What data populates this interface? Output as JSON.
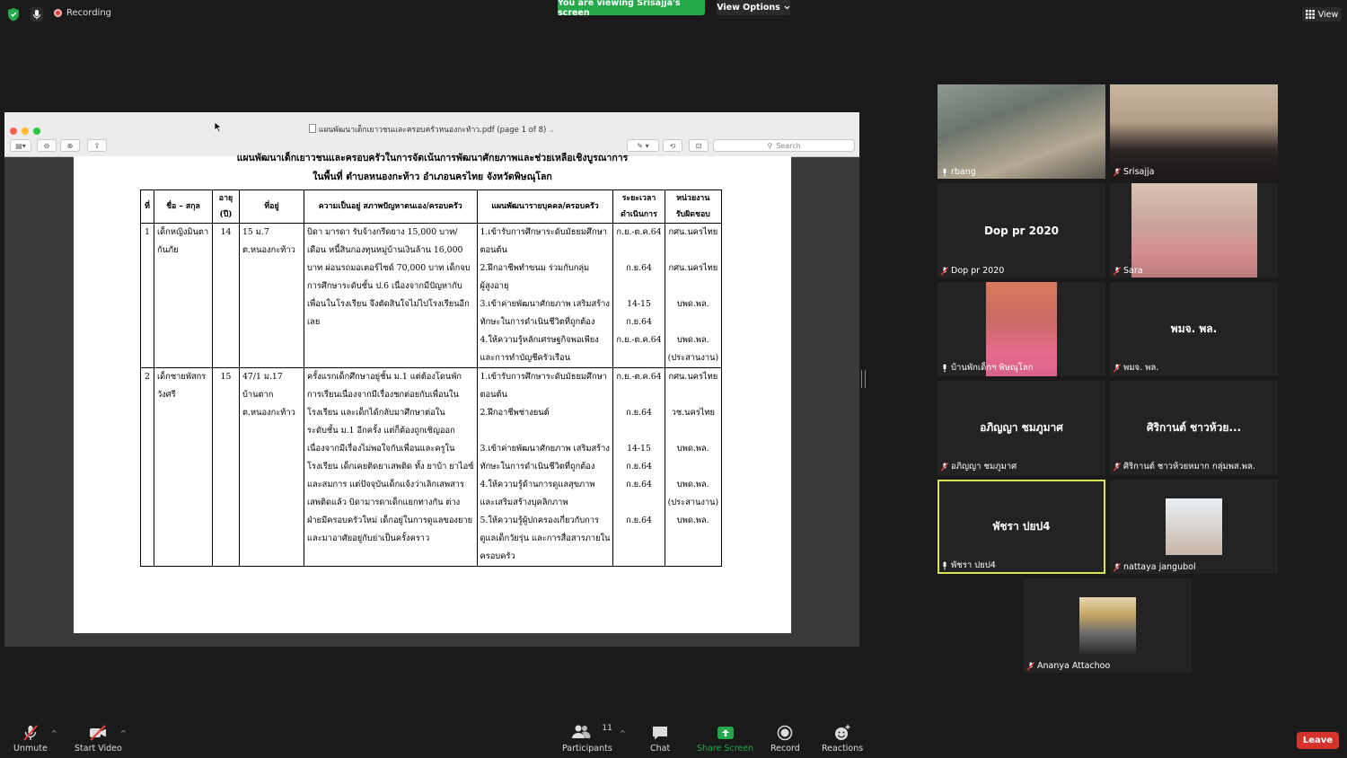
{
  "topbar": {
    "recording_label": "Recording",
    "viewing_banner": "You are viewing Srisajja's screen",
    "view_options_label": "View Options",
    "view_label": "View",
    "colors": {
      "banner_green": "#23a94a",
      "recording_red": "#e2403b"
    }
  },
  "preview": {
    "title": "แผนพัฒนาเด็กเยาวชนและครอบครัวหนองกะท้าว.pdf (page 1 of 8)",
    "search_placeholder": "Search"
  },
  "document": {
    "heading_1": "แผนพัฒนาเด็กเยาวชนและครอบครัวในการจัดเน้นการพัฒนาศักยภาพและช่วยเหลือเชิงบูรณาการ",
    "heading_2": "ในพื้นที่ ตำบลหนองกะท้าว อำเภอนครไทย จังหวัดพิษณุโลก",
    "headers": {
      "no": "ที่",
      "name": "ชื่อ – สกุล",
      "age_1": "อายุ",
      "age_2": "(ปี)",
      "address": "ที่อยู่",
      "situation": "ความเป็นอยู่ สภาพปัญหาตนเอง/ครอบครัว",
      "plan": "แผนพัฒนารายบุคคล/ครอบครัว",
      "period_1": "ระยะเวลา",
      "period_2": "ดำเนินการ",
      "agency_1": "หน่วยงาน",
      "agency_2": "รับผิดชอบ"
    },
    "rows": [
      {
        "no": "1",
        "name": [
          "เด็กหญิงมินตา",
          "กันภัย"
        ],
        "age": "14",
        "address": [
          "15 ม.7",
          "ต.หนองกะท้าว"
        ],
        "situation": [
          "บิดา มารดา รับจ้างกรีดยาง 15,000 บาท/",
          "เดือน หนี้สินกองทุนหมู่บ้านเงินล้าน 16,000",
          "บาท ผ่อนรถมอเตอร์ไซด์ 70,000 บาท เด็กจบ",
          "การศึกษาระดับชั้น ป.6 เนื่องจากมีปัญหากับ",
          "เพื่อนในโรงเรียน จึงตัดสินใจไม่ไปโรงเรียนอีก",
          "เลย"
        ],
        "plan": [
          "1.เข้ารับการศึกษาระดับมัธยมศึกษา",
          "ตอนต้น",
          "2.ฝึกอาชีพทำขนม ร่วมกับกลุ่ม",
          "ผู้สูงอายุ",
          "3.เข้าค่ายพัฒนาศักยภาพ เสริมสร้าง",
          "ทักษะในการดำเนินชีวิตที่ถูกต้อง",
          "4.ให้ความรู้หลักเศรษฐกิจพอเพียง",
          "และการทำบัญชีครัวเรือน"
        ],
        "period": [
          "ก.ย.-ต.ค.64",
          "",
          "ก.ย.64",
          "",
          "14-15",
          "ก.ย.64",
          "ก.ย.-ต.ค.64",
          ""
        ],
        "agency": [
          "กศน.นครไทย",
          "",
          "กศน.นครไทย",
          "",
          "บพด.พล.",
          "",
          "บพด.พล.",
          "(ประสานงาน)"
        ]
      },
      {
        "no": "2",
        "name": [
          "เด็กชายพัสกร",
          "วังศรี"
        ],
        "age": "15",
        "address": [
          "47/1 ม.17",
          "บ้านตาก",
          "ต.หนองกะท้าว"
        ],
        "situation": [
          "ครั้งแรกเด็กศึกษาอยู่ชั้น ม.1 แต่ต้องโดนพัก",
          "การเรียนเนื่องจากมีเรื่องชกต่อยกับเพื่อนใน",
          "โรงเรียน และเด็กได้กลับมาศึกษาต่อใน",
          "ระดับชั้น ม.1 อีกครั้ง แต่ก็ต้องถูกเชิญออก",
          "เนื่องจากมีเรื่องไม่พอใจกับเพื่อนและครูใน",
          "โรงเรียน เด็กเคยติดยาเสพติด ทั้ง ยาบ้า ยาไอซ์",
          "และสมการ แต่ปัจจุบันเด็กแจ้งว่าเลิกเสพสาร",
          "เสพติดแล้ว บิดามารดาเด็กแยกทางกัน ต่าง",
          "ฝ่ายมีครอบครัวใหม่ เด็กอยู่ในการดูแลของยาย",
          "และมาอาศัยอยู่กับย่าเป็นครั้งคราว"
        ],
        "plan": [
          "1.เข้ารับการศึกษาระดับมัธยมศึกษา",
          "ตอนต้น",
          "2.ฝึกอาชีพช่างยนต์",
          "",
          "3.เข้าค่ายพัฒนาศักยภาพ เสริมสร้าง",
          "ทักษะในการดำเนินชีวิตที่ถูกต้อง",
          "4.ให้ความรู้ด้านการดูแลสุขภาพ",
          "และเสริมสร้างบุคลิกภาพ",
          "5.ให้ความรู้ผู้ปกครองเกี่ยวกับการ",
          "ดูแลเด็กวัยรุ่น และการสื่อสารภายใน",
          "ครอบครัว"
        ],
        "period": [
          "ก.ย.-ต.ค.64",
          "",
          "ก.ย.64",
          "",
          "14-15",
          "ก.ย.64",
          "ก.ย.64",
          "",
          "ก.ย.64",
          "",
          ""
        ],
        "agency": [
          "กศน.นครไทย",
          "",
          "วช.นครไทย",
          "",
          "บพด.พล.",
          "",
          "บพด.พล.",
          "(ประสานงาน)",
          "บพด.พล.",
          "",
          ""
        ]
      }
    ]
  },
  "participants": [
    {
      "name": "rbang",
      "display": "",
      "video": true,
      "muted": false
    },
    {
      "name": "Srisajja",
      "display": "",
      "video": true,
      "muted": true
    },
    {
      "name": "Dop pr 2020",
      "display": "Dop pr 2020",
      "video": false,
      "muted": true
    },
    {
      "name": "Sara",
      "display": "",
      "video": true,
      "muted": true
    },
    {
      "name": "บ้านพักเด็กฯ พิษณุโลก",
      "display": "",
      "video": true,
      "muted": false
    },
    {
      "name": "พมจ. พล.",
      "display": "พมจ. พล.",
      "video": false,
      "muted": true
    },
    {
      "name": "อภิญญา ชมภูมาศ",
      "display": "อภิญญา ชมภูมาศ",
      "video": false,
      "muted": true
    },
    {
      "name": "ศิริกานต์ ชาวห้วยหมาก กลุ่มพส.พล.",
      "display": "ศิริกานต์ ชาวห้วย...",
      "video": false,
      "muted": true
    },
    {
      "name": "พัชรา ปยป4",
      "display": "พัชรา ปยป4",
      "video": false,
      "muted": false
    },
    {
      "name": "nattaya jangubol",
      "display": "",
      "video": true,
      "muted": true
    },
    {
      "name": "Ananya Attachoo",
      "display": "",
      "video": true,
      "muted": true
    }
  ],
  "toolbar": {
    "unmute": "Unmute",
    "start_video": "Start Video",
    "participants": "Participants",
    "participant_count": "11",
    "chat": "Chat",
    "share_screen": "Share Screen",
    "record": "Record",
    "reactions": "Reactions",
    "leave": "Leave",
    "colors": {
      "share_green": "#23a94a",
      "leave_red": "#d6332c"
    }
  }
}
